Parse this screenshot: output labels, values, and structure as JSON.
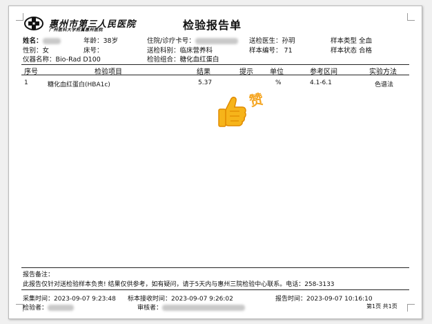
{
  "hospital": {
    "name": "惠州市第三人民医院",
    "subtitle": "广州医科大学附属惠州医院"
  },
  "title": "检验报告单",
  "patient": {
    "name_label": "姓名：",
    "gender_label": "性别：",
    "gender": "女",
    "instrument_label": "仪器名称：",
    "instrument": "Bio-Rad D100",
    "age_label": "年龄：",
    "age": "38岁",
    "bed_label": "床号：",
    "bed": "",
    "inpatient_label": "住院/诊疗卡号：",
    "dept_label": "送检科别：",
    "dept": "临床营养科",
    "combo_label": "检验组合：",
    "combo": "糖化血红蛋白",
    "doctor_label": "送检医生：",
    "doctor": "孙玥",
    "sample_no_label": "样本编号：",
    "sample_no": "71",
    "sample_type_label": "样本类型",
    "sample_type": "全血",
    "sample_status_label": "样本状态",
    "sample_status": "合格"
  },
  "table": {
    "headers": [
      "序号",
      "检验项目",
      "结果",
      "提示",
      "单位",
      "参考区间",
      "实验方法"
    ],
    "rows": [
      {
        "no": "1",
        "item": "糖化血红蛋白(HBA1c)",
        "result": "5.37",
        "hint": "",
        "unit": "%",
        "range": "4.1-6.1",
        "method": "色谱法"
      }
    ]
  },
  "sticker": {
    "text": "赞",
    "color": "#f5a623"
  },
  "remarks": {
    "label": "报告备注：",
    "text": "此报告仅针对送检验样本负责! 结果仅供参考，如有疑问，请于5天内与惠州三院检验中心联系。电话：258-3133"
  },
  "footer": {
    "collect_label": "采集时间：",
    "collect_time": "2023-09-07 9:23:48",
    "receive_label": "标本接收时间：",
    "receive_time": "2023-09-07 9:26:02",
    "report_label": "报告时间：",
    "report_time": "2023-09-07 10:16:10",
    "tester_label": "检验者：",
    "reviewer_label": "审核者：",
    "page_info": "第1页 共1页"
  }
}
